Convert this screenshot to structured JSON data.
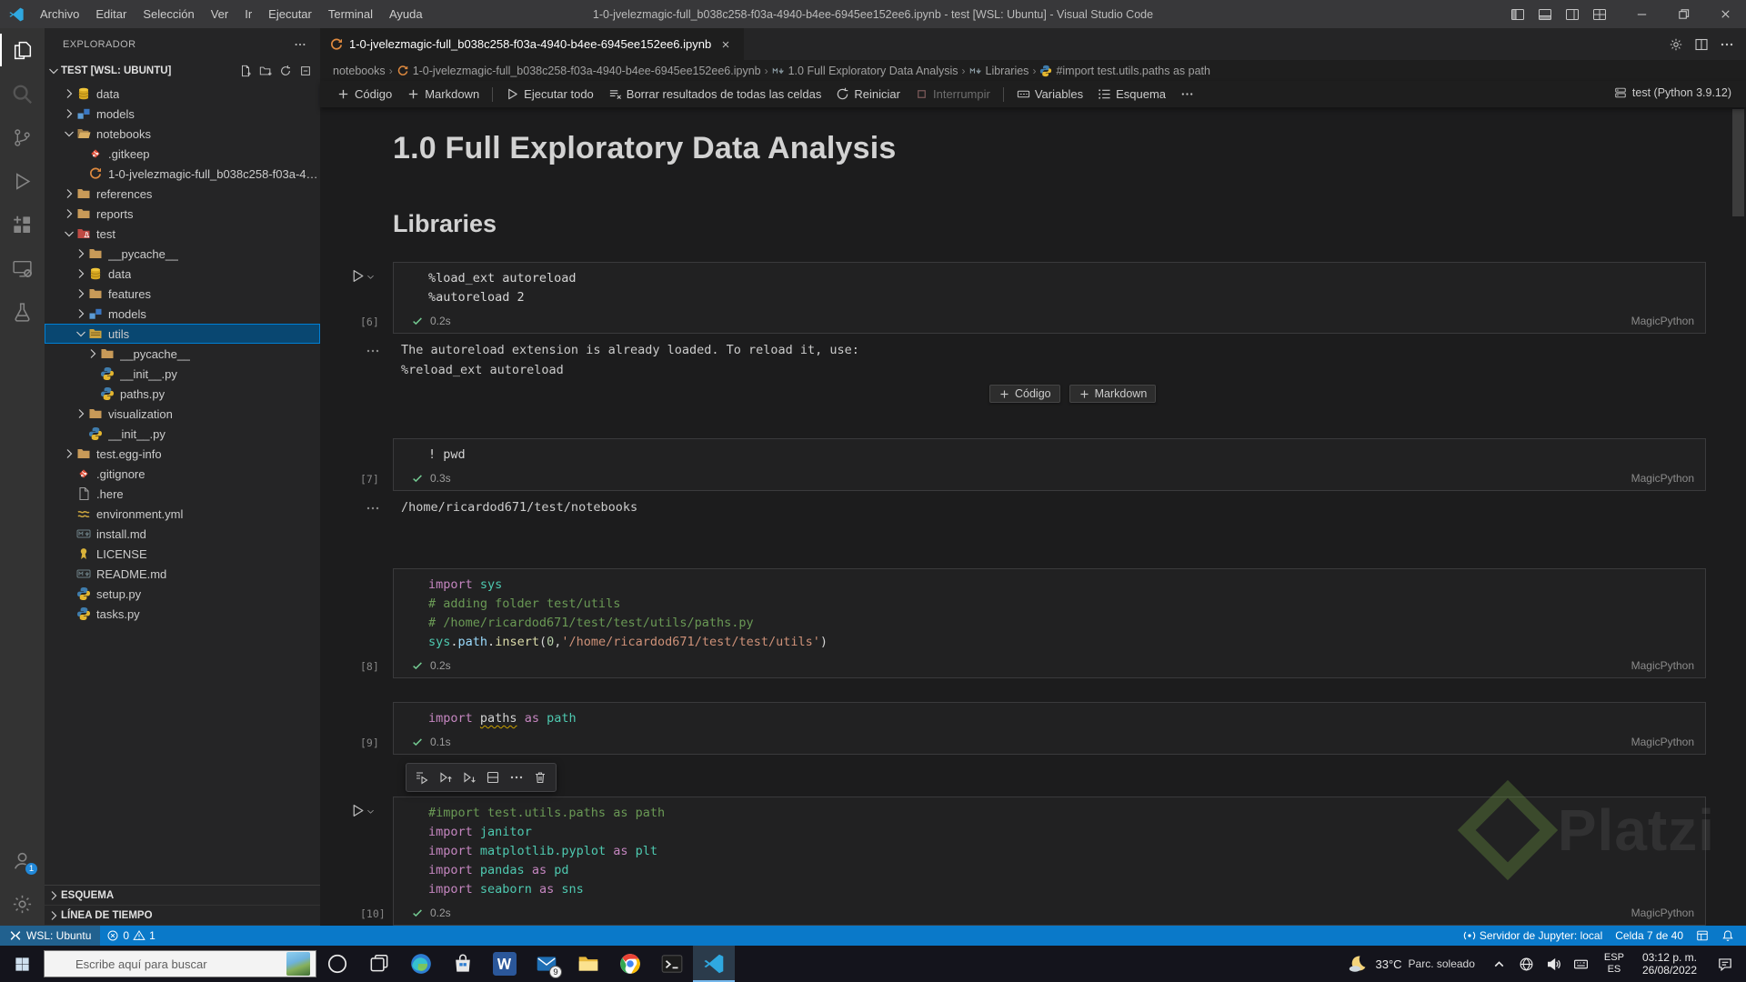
{
  "titlebar": {
    "menus": [
      "Archivo",
      "Editar",
      "Selección",
      "Ver",
      "Ir",
      "Ejecutar",
      "Terminal",
      "Ayuda"
    ],
    "title": "1-0-jvelezmagic-full_b038c258-f03a-4940-b4ee-6945ee152ee6.ipynb - test [WSL: Ubuntu] - Visual Studio Code"
  },
  "activity_bar": {
    "top": [
      {
        "name": "explorer",
        "active": true
      },
      {
        "name": "search"
      },
      {
        "name": "source-control"
      },
      {
        "name": "run-debug"
      },
      {
        "name": "extensions"
      },
      {
        "name": "remote-explorer"
      },
      {
        "name": "testing"
      }
    ],
    "bottom": [
      {
        "name": "accounts",
        "badge": "1"
      },
      {
        "name": "settings"
      }
    ]
  },
  "sidebar": {
    "title": "EXPLORADOR",
    "section": {
      "label": "TEST [WSL: UBUNTU]",
      "actions": [
        "new-file",
        "new-folder",
        "refresh",
        "collapse-all"
      ]
    },
    "tree": [
      {
        "label": "data",
        "icon": "database",
        "depth": 1,
        "chevron": "right"
      },
      {
        "label": "models",
        "icon": "models",
        "depth": 1,
        "chevron": "right"
      },
      {
        "label": "notebooks",
        "icon": "folder-open",
        "depth": 1,
        "chevron": "down"
      },
      {
        "label": ".gitkeep",
        "icon": "git",
        "depth": 2
      },
      {
        "label": "1-0-jvelezmagic-full_b038c258-f03a-49...",
        "icon": "notebook",
        "depth": 2
      },
      {
        "label": "references",
        "icon": "folder",
        "depth": 1,
        "chevron": "right"
      },
      {
        "label": "reports",
        "icon": "folder",
        "depth": 1,
        "chevron": "right"
      },
      {
        "label": "test",
        "icon": "folder-test",
        "depth": 1,
        "chevron": "down"
      },
      {
        "label": "__pycache__",
        "icon": "folder",
        "depth": 2,
        "chevron": "right"
      },
      {
        "label": "data",
        "icon": "database",
        "depth": 2,
        "chevron": "right"
      },
      {
        "label": "features",
        "icon": "folder",
        "depth": 2,
        "chevron": "right"
      },
      {
        "label": "models",
        "icon": "models",
        "depth": 2,
        "chevron": "right"
      },
      {
        "label": "utils",
        "icon": "folder-utils",
        "depth": 2,
        "chevron": "down",
        "selected": true
      },
      {
        "label": "__pycache__",
        "icon": "folder",
        "depth": 3,
        "chevron": "right"
      },
      {
        "label": "__init__.py",
        "icon": "python",
        "depth": 3
      },
      {
        "label": "paths.py",
        "icon": "python",
        "depth": 3
      },
      {
        "label": "visualization",
        "icon": "folder",
        "depth": 2,
        "chevron": "right"
      },
      {
        "label": "__init__.py",
        "icon": "python",
        "depth": 2
      },
      {
        "label": "test.egg-info",
        "icon": "folder",
        "depth": 1,
        "chevron": "right"
      },
      {
        "label": ".gitignore",
        "icon": "git",
        "depth": 1
      },
      {
        "label": ".here",
        "icon": "file",
        "depth": 1
      },
      {
        "label": "environment.yml",
        "icon": "yaml",
        "depth": 1
      },
      {
        "label": "install.md",
        "icon": "markdown",
        "depth": 1
      },
      {
        "label": "LICENSE",
        "icon": "license",
        "depth": 1
      },
      {
        "label": "README.md",
        "icon": "markdown",
        "depth": 1
      },
      {
        "label": "setup.py",
        "icon": "python",
        "depth": 1
      },
      {
        "label": "tasks.py",
        "icon": "python",
        "depth": 1
      }
    ],
    "bottom_sections": [
      "ESQUEMA",
      "LÍNEA DE TIEMPO"
    ]
  },
  "editor": {
    "tab": {
      "label": "1-0-jvelezmagic-full_b038c258-f03a-4940-b4ee-6945ee152ee6.ipynb"
    },
    "tab_actions": [
      "run-settings",
      "split-editor",
      "more"
    ],
    "breadcrumbs": [
      {
        "label": "notebooks"
      },
      {
        "label": "1-0-jvelezmagic-full_b038c258-f03a-4940-b4ee-6945ee152ee6.ipynb",
        "icon": "notebook"
      },
      {
        "label": "1.0 Full Exploratory Data Analysis",
        "icon": "markdown-symbol"
      },
      {
        "label": "Libraries",
        "icon": "markdown-symbol"
      },
      {
        "label": "#import test.utils.paths as path",
        "icon": "code-symbol"
      }
    ],
    "toolbar": [
      {
        "label": "Código",
        "icon": "plus"
      },
      {
        "label": "Markdown",
        "icon": "plus"
      },
      {
        "sep": true
      },
      {
        "label": "Ejecutar todo",
        "icon": "play"
      },
      {
        "label": "Borrar resultados de todas las celdas",
        "icon": "clear-all"
      },
      {
        "label": "Reiniciar",
        "icon": "restart"
      },
      {
        "label": "Interrumpir",
        "icon": "interrupt",
        "disabled": true
      },
      {
        "sep": true
      },
      {
        "label": "Variables",
        "icon": "variables"
      },
      {
        "label": "Esquema",
        "icon": "outline"
      },
      {
        "label": "",
        "icon": "more"
      }
    ],
    "kernel_label": "test (Python 3.9.12)",
    "h1": "1.0 Full Exploratory Data Analysis",
    "h2": "Libraries",
    "insert_buttons": [
      "Código",
      "Markdown"
    ],
    "cell_toolbar_icons": [
      "run-by-line",
      "execute-above",
      "execute-below",
      "split-cell",
      "more",
      "delete-cell"
    ],
    "cells": [
      {
        "exec": "[6]",
        "time": "0.2s",
        "lang": "MagicPython",
        "run_button": true,
        "insert_after": true,
        "code": [
          [
            [
              "d",
              "%load_ext autoreload"
            ]
          ],
          [
            [
              "d",
              "%autoreload 2"
            ]
          ]
        ],
        "output": [
          "The autoreload extension is already loaded. To reload it, use:",
          "  %reload_ext autoreload"
        ]
      },
      {
        "exec": "[7]",
        "time": "0.3s",
        "lang": "MagicPython",
        "code": [
          [
            [
              "d",
              "! pwd"
            ]
          ]
        ],
        "output": [
          "/home/ricardod671/test/notebooks"
        ]
      },
      {
        "exec": "[8]",
        "time": "0.2s",
        "lang": "MagicPython",
        "code": [
          [
            [
              "k",
              "import"
            ],
            [
              "d",
              " "
            ],
            [
              "m",
              "sys"
            ]
          ],
          [
            [
              "c",
              "# adding folder test/utils"
            ]
          ],
          [
            [
              "c",
              "# /home/ricardod671/test/test/utils/paths.py"
            ]
          ],
          [
            [
              "m",
              "sys"
            ],
            [
              "d",
              "."
            ],
            [
              "p",
              "path"
            ],
            [
              "d",
              "."
            ],
            [
              "f",
              "insert"
            ],
            [
              "d",
              "("
            ],
            [
              "n",
              "0"
            ],
            [
              "d",
              ","
            ],
            [
              "s",
              "'/home/ricardod671/test/test/utils'"
            ],
            [
              "d",
              ")"
            ]
          ]
        ]
      },
      {
        "exec": "[9]",
        "time": "0.1s",
        "lang": "MagicPython",
        "code": [
          [
            [
              "k",
              "import"
            ],
            [
              "d",
              " "
            ],
            [
              "u",
              "paths"
            ],
            [
              "d",
              " "
            ],
            [
              "k",
              "as"
            ],
            [
              "d",
              " "
            ],
            [
              "m",
              "path"
            ]
          ]
        ]
      },
      {
        "exec": "[10]",
        "time": "0.2s",
        "lang": "MagicPython",
        "run_button": true,
        "toolbar_above": true,
        "code": [
          [
            [
              "c",
              "#import test.utils.paths as path"
            ]
          ],
          [
            [
              "k",
              "import"
            ],
            [
              "d",
              " "
            ],
            [
              "m",
              "janitor"
            ]
          ],
          [
            [
              "k",
              "import"
            ],
            [
              "d",
              " "
            ],
            [
              "m",
              "matplotlib.pyplot"
            ],
            [
              "d",
              " "
            ],
            [
              "k",
              "as"
            ],
            [
              "d",
              " "
            ],
            [
              "m",
              "plt"
            ]
          ],
          [
            [
              "k",
              "import"
            ],
            [
              "d",
              " "
            ],
            [
              "m",
              "pandas"
            ],
            [
              "d",
              " "
            ],
            [
              "k",
              "as"
            ],
            [
              "d",
              " "
            ],
            [
              "m",
              "pd"
            ]
          ],
          [
            [
              "k",
              "import"
            ],
            [
              "d",
              " "
            ],
            [
              "m",
              "seaborn"
            ],
            [
              "d",
              " "
            ],
            [
              "k",
              "as"
            ],
            [
              "d",
              " "
            ],
            [
              "m",
              "sns"
            ]
          ]
        ]
      }
    ],
    "watermark": "Platzi"
  },
  "status_bar": {
    "remote_label": "WSL: Ubuntu",
    "errors": "0",
    "warnings": "1",
    "right": [
      {
        "icon": "jupyter",
        "label": "Servidor de Jupyter: local"
      },
      {
        "label": "Celda 7 de 40"
      },
      {
        "icon": "cell-layout",
        "label": ""
      },
      {
        "icon": "bell",
        "label": ""
      }
    ]
  },
  "taskbar": {
    "search_placeholder": "Escribe aquí para buscar",
    "apps": [
      {
        "name": "cortana"
      },
      {
        "name": "task-view"
      },
      {
        "name": "edge"
      },
      {
        "name": "store"
      },
      {
        "name": "word"
      },
      {
        "name": "mail",
        "badge": "9"
      },
      {
        "name": "file-explorer"
      },
      {
        "name": "chrome"
      },
      {
        "name": "terminal"
      },
      {
        "name": "vscode",
        "active": true
      }
    ],
    "tray": {
      "weather_temp": "33°C",
      "weather_desc": "Parc. soleado",
      "icons": [
        "hidden-icons",
        "network",
        "volume",
        "keyboard"
      ],
      "lang": [
        "ESP",
        "ES"
      ],
      "time": "03:12 p. m.",
      "date": "26/08/2022"
    }
  }
}
